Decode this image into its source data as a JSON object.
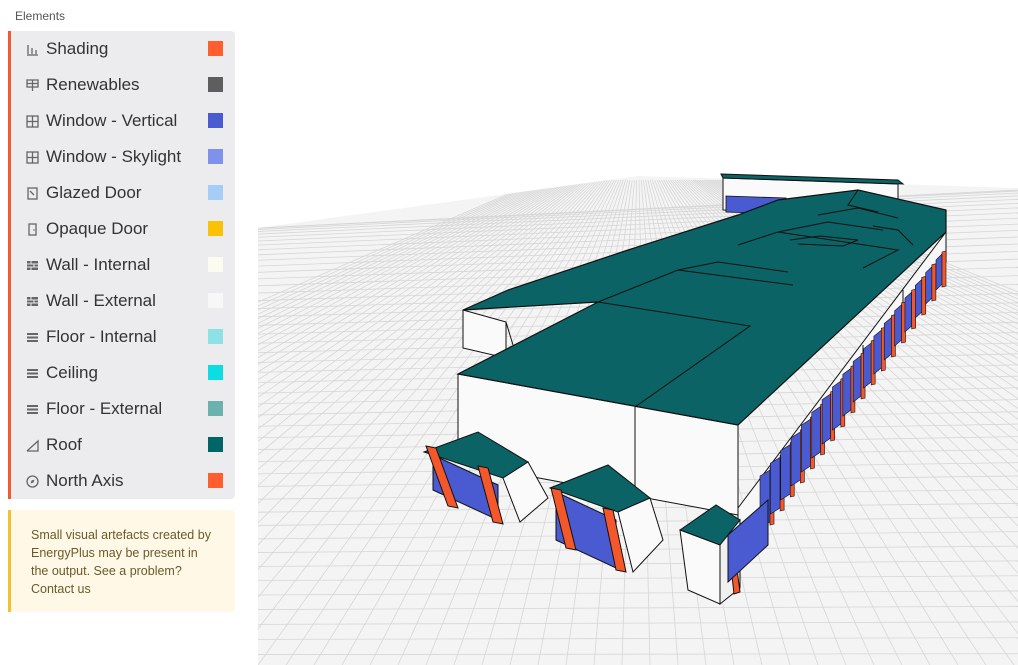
{
  "panel": {
    "title": "Elements"
  },
  "legend": {
    "items": [
      {
        "label": "Shading",
        "icon": "shading-icon",
        "color": "#ff5e2e"
      },
      {
        "label": "Renewables",
        "icon": "renewables-icon",
        "color": "#5e5e5e"
      },
      {
        "label": "Window - Vertical",
        "icon": "window-icon",
        "color": "#4a5bd1"
      },
      {
        "label": "Window - Skylight",
        "icon": "window-icon",
        "color": "#7f91ea"
      },
      {
        "label": "Glazed Door",
        "icon": "glazed-door-icon",
        "color": "#a5cdf7"
      },
      {
        "label": "Opaque Door",
        "icon": "opaque-door-icon",
        "color": "#fbc107"
      },
      {
        "label": "Wall - Internal",
        "icon": "wall-icon",
        "color": "#fbfbef"
      },
      {
        "label": "Wall - External",
        "icon": "wall-icon",
        "color": "#f7f7f7"
      },
      {
        "label": "Floor - Internal",
        "icon": "floor-icon",
        "color": "#8ce2e4"
      },
      {
        "label": "Ceiling",
        "icon": "floor-icon",
        "color": "#0bdde2"
      },
      {
        "label": "Floor - External",
        "icon": "floor-icon",
        "color": "#6bb2ae"
      },
      {
        "label": "Roof",
        "icon": "roof-icon",
        "color": "#006566"
      },
      {
        "label": "North Axis",
        "icon": "compass-icon",
        "color": "#ff5e2e"
      }
    ]
  },
  "notice": {
    "text": "Small visual artefacts created by EnergyPlus may be present in the output. See a problem? Contact us"
  },
  "scene": {
    "roof_color": "#0b6366",
    "wall_color": "#fafafa",
    "window_color": "#4a5bd1",
    "shade_color": "#f4572a",
    "grid_color": "#d6d6d6",
    "ground_color": "#f4f4f4"
  }
}
